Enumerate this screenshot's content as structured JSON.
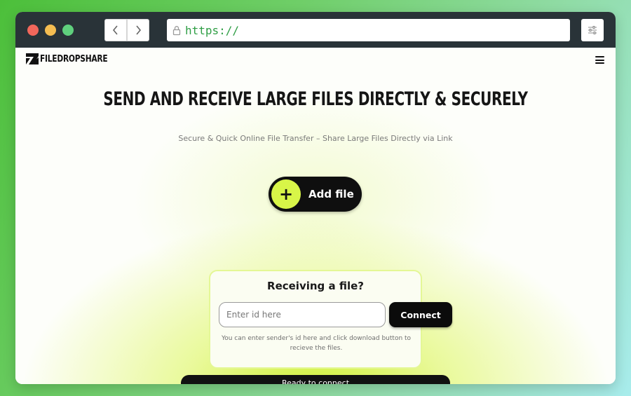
{
  "browser": {
    "url": "https://",
    "icons": {
      "back": "chevron-left-icon",
      "forward": "chevron-right-icon",
      "lock": "lock-icon",
      "settings": "sliders-icon"
    },
    "traffic_lights": [
      "#f2675b",
      "#f4bd51",
      "#5fd07d"
    ]
  },
  "site": {
    "logo_text": "FILEDROPSHARE",
    "menu_icon": "hamburger-menu-icon"
  },
  "hero": {
    "headline": "SEND AND RECEIVE LARGE FILES DIRECTLY & SECURELY",
    "subheadline": "Secure & Quick Online File Transfer – Share Large Files Directly via Link",
    "add_file_label": "Add file",
    "add_file_icon": "plus-icon"
  },
  "receive": {
    "title": "Receiving a file?",
    "input_value": "",
    "input_placeholder": "Enter id here",
    "connect_label": "Connect",
    "hint": "You can enter sender's id here and click download button to recieve the files."
  },
  "status": {
    "text": "Ready to connect"
  },
  "colors": {
    "accent": "#d8f548",
    "url_green": "#2f9e45",
    "chrome": "#293338"
  }
}
